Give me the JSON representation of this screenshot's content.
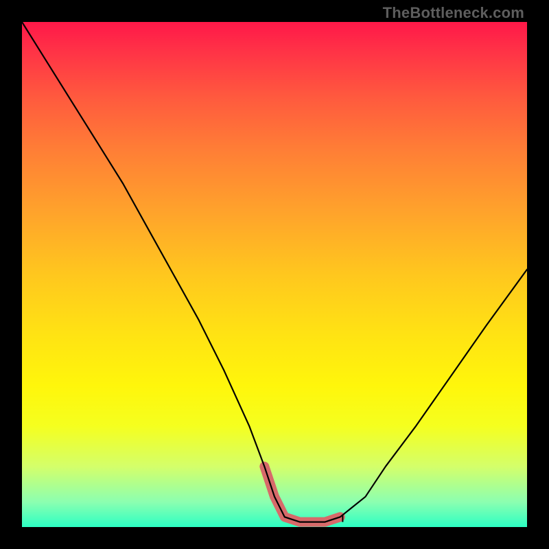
{
  "watermark": "TheBottleneck.com",
  "colors": {
    "frame": "#000000",
    "curve": "#000000",
    "valley_highlight": "#d76a6a",
    "gradient_top": "#ff1848",
    "gradient_bottom": "#2cffc3"
  },
  "chart_data": {
    "type": "line",
    "title": "",
    "xlabel": "",
    "ylabel": "",
    "xlim": [
      0,
      100
    ],
    "ylim": [
      0,
      100
    ],
    "grid": false,
    "legend": false,
    "background": "vertical-gradient red→green",
    "series": [
      {
        "name": "bottleneck-curve",
        "x": [
          0,
          5,
          10,
          15,
          20,
          25,
          30,
          35,
          40,
          45,
          48,
          50,
          52,
          55,
          58,
          60,
          63,
          68,
          72,
          78,
          85,
          92,
          100
        ],
        "y": [
          100,
          92,
          84,
          76,
          68,
          59,
          50,
          41,
          31,
          20,
          12,
          6,
          2,
          1,
          1,
          1,
          2,
          6,
          12,
          20,
          30,
          40,
          51
        ]
      }
    ],
    "annotations": [
      {
        "name": "valley-highlight",
        "type": "segment-overlay",
        "color": "#d76a6a",
        "x_range": [
          48,
          66
        ],
        "y_approx": 1
      }
    ],
    "notes": "Asymmetric V-shaped curve dipping to near-zero around x≈55–60; left branch starts at y=100 (top-left), right branch rises to y≈51 by x=100. Values read off plot-area proportions; axes unlabeled."
  }
}
